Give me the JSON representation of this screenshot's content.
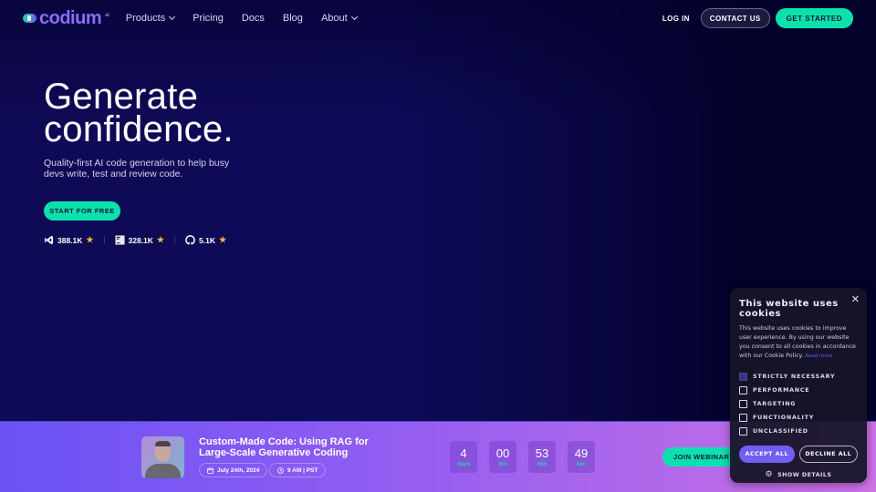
{
  "nav": {
    "logo_text": "codium",
    "logo_suffix": "ai",
    "links": [
      {
        "label": "Products",
        "has_dropdown": true
      },
      {
        "label": "Pricing",
        "has_dropdown": false
      },
      {
        "label": "Docs",
        "has_dropdown": false
      },
      {
        "label": "Blog",
        "has_dropdown": false
      },
      {
        "label": "About",
        "has_dropdown": true
      }
    ],
    "login_label": "LOG IN",
    "contact_label": "CONTACT US",
    "get_started_label": "GET STARTED"
  },
  "hero": {
    "title_line1": "Generate",
    "title_line2": "confidence.",
    "subtitle": "Quality-first AI code generation to help busy devs write, test and review code.",
    "cta_label": "START FOR FREE",
    "stats": [
      {
        "icon": "vscode-icon",
        "value": "388.1K"
      },
      {
        "icon": "jetbrains-icon",
        "value": "328.1K"
      },
      {
        "icon": "github-icon",
        "value": "5.1K"
      }
    ]
  },
  "webinar": {
    "title": "Custom-Made Code: Using RAG for Large-Scale Generative Coding",
    "date": "July 24th, 2024",
    "time": "9 AM | PST",
    "countdown": [
      {
        "value": "4",
        "label": "days"
      },
      {
        "value": "00",
        "label": "hrs"
      },
      {
        "value": "53",
        "label": "min"
      },
      {
        "value": "49",
        "sec": true,
        "label": "sec"
      }
    ],
    "join_label": "JOIN WEBINAR"
  },
  "cookie": {
    "title": "This website uses cookies",
    "description": "This website uses cookies to improve user experience. By using our website you consent to all cookies in accordance with our Cookie Policy.",
    "read_more": "Read more",
    "categories": [
      {
        "label": "STRICTLY NECESSARY",
        "checked": true
      },
      {
        "label": "PERFORMANCE",
        "checked": false
      },
      {
        "label": "TARGETING",
        "checked": false
      },
      {
        "label": "FUNCTIONALITY",
        "checked": false
      },
      {
        "label": "UNCLASSIFIED",
        "checked": false
      }
    ],
    "accept_label": "ACCEPT ALL",
    "decline_label": "DECLINE ALL",
    "details_label": "SHOW DETAILS"
  },
  "colors": {
    "accent_teal": "#0ee0ad",
    "brand_purple": "#8a6cff",
    "background_navy": "#0e0a58",
    "star": "#f4b740"
  }
}
